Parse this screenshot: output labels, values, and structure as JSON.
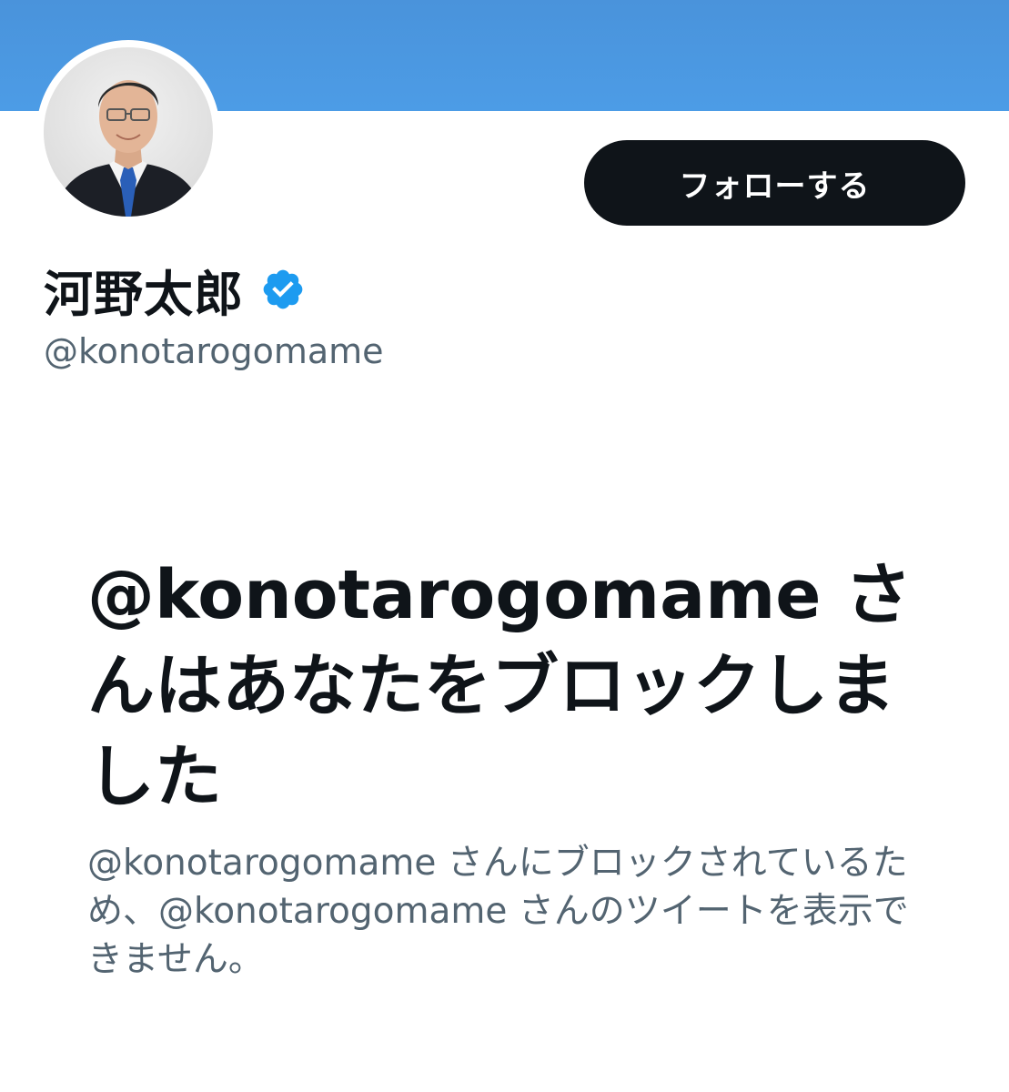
{
  "profile": {
    "display_name": "河野太郎",
    "handle": "@konotarogomame",
    "verified": true,
    "avatar": "profile-photo"
  },
  "follow_button": {
    "label": "フォローする"
  },
  "blocked_notice": {
    "title": "@konotarogomame さんはあなたをブロックしました",
    "description": "@konotarogomame さんにブロックされているため、@konotarogomame さんのツイートを表示できません。"
  },
  "colors": {
    "banner": "#4a97e2",
    "button_bg": "#0f1419",
    "verified_badge": "#1d9bf0",
    "secondary_text": "#536471"
  },
  "icons": [
    "verified-badge-icon"
  ]
}
